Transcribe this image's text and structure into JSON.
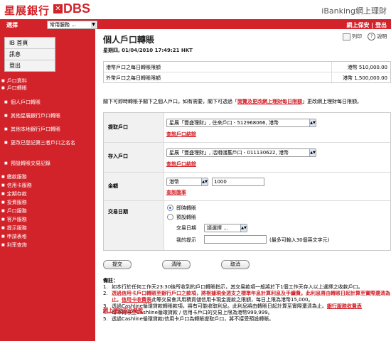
{
  "header": {
    "logo_cn": "星展銀行",
    "logo_en": "DBS",
    "brand_right": "iBanking網上理財",
    "select_label": "選擇",
    "services_dropdown": "常用服務 ...",
    "security_link": "網上保安",
    "divider": "|",
    "logout_link": "登出",
    "brand_color": "#d2232a"
  },
  "quick_nav": [
    "IB 首頁",
    "訊息",
    "登出"
  ],
  "nav": {
    "sections_top": [
      "戶口資料",
      "戶口轉賬"
    ],
    "sub_items": [
      "個人戶口轉賬",
      "其他星展銀行戶口轉賬",
      "其他本地銀行戶口轉賬",
      "更改已登記第三者戶口之名名",
      "預設轉賬交易記錄"
    ],
    "sections_bottom": [
      "繳款服務",
      "信用卡服務",
      "定期存款",
      "投資服務",
      "戶口服務",
      "客戶服務",
      "提示服務",
      "申請表格",
      "利率查詢"
    ]
  },
  "page": {
    "title": "個人戶口轉賬",
    "datetime": "星期四, 01/04/2010 17:49:21 HKT",
    "print_label": "列印",
    "help_label": "?",
    "help_text": "說明"
  },
  "limits": [
    {
      "label": "港幣戶口之每日轉賬限額",
      "value": "港幣 510,000.00"
    },
    {
      "label": "外幣戶口之每日轉賬限額",
      "value": "港幣 1,500,000.00"
    }
  ],
  "description": {
    "before": "閣下可即時轉賬予閣下之個人戶口。如有需要，閣下可透過「",
    "link": "閱覽及更改網上理財每日限額",
    "after": "」更改網上理財每日限額。"
  },
  "form": {
    "from_label": "提取戶口",
    "from_value": "星展「豐盛理財」, 往來戶口 - 512968066, 港幣",
    "from_link": "查詢戶口結餘",
    "to_label": "存入戶口",
    "to_value": "星展「豐盛理財」, 活期儲蓄戶口 - 011130622, 港幣",
    "to_link": "查詢戶口結餘",
    "amount_label": "金額",
    "currency_value": "港幣",
    "amount_value": "1000",
    "rate_link": "查詢匯率",
    "date_label": "交易日期",
    "option_now": "即時轉賬",
    "option_scheduled": "預設轉賬",
    "txn_date_label": "交易日期",
    "txn_date_select": "請選擇 ...",
    "memo_label": "我的提示",
    "memo_value": "",
    "memo_hint": "(最多可輸入30個英文字元)"
  },
  "buttons": {
    "submit": "提交",
    "clear": "清除",
    "cancel": "取消"
  },
  "notes": {
    "title": "備註：",
    "items": [
      {
        "num": "1.",
        "parts": [
          {
            "t": "如本行於任何工作天23:30後所收到的戶口轉賬指示，其交易款項一般將於下1個工作天存入以上選擇之收款戶口。",
            "s": ""
          }
        ]
      },
      {
        "num": "2.",
        "parts": [
          {
            "t": "透過信用卡戶口轉賬至銀行戶口之款項，將根據現金透支之標準年息計算利息及手續費。此利息將由轉賬日起計算至實際還清為止。",
            "s": "red"
          },
          {
            "t": "信用卡收費表",
            "s": "lk"
          },
          {
            "t": "此等交易會共用積貨儲信用卡現金提款之限額，每日上限為港幣15,000。",
            "s": ""
          }
        ]
      },
      {
        "num": "3.",
        "parts": [
          {
            "t": "透過Cashline循環貸款轉賬款項，將有可能收取利息。此利息將由轉賬日起計算至實際還清為止。",
            "s": ""
          },
          {
            "t": "銀行服務收費表",
            "s": "lk"
          }
        ]
      },
      {
        "num": "4.",
        "parts": [
          {
            "t": "每筆轉賬至Cashline循環貸款 / 信用卡戶口的交易上限為港幣999,999。",
            "s": ""
          }
        ]
      },
      {
        "num": "5.",
        "parts": [
          {
            "t": "透過Cashline循環貸款/信用卡戶口為轉賬提取戶口，將不接受預設轉賬。",
            "s": ""
          }
        ]
      }
    ]
  },
  "bottom_link": "網上理財安全條款"
}
